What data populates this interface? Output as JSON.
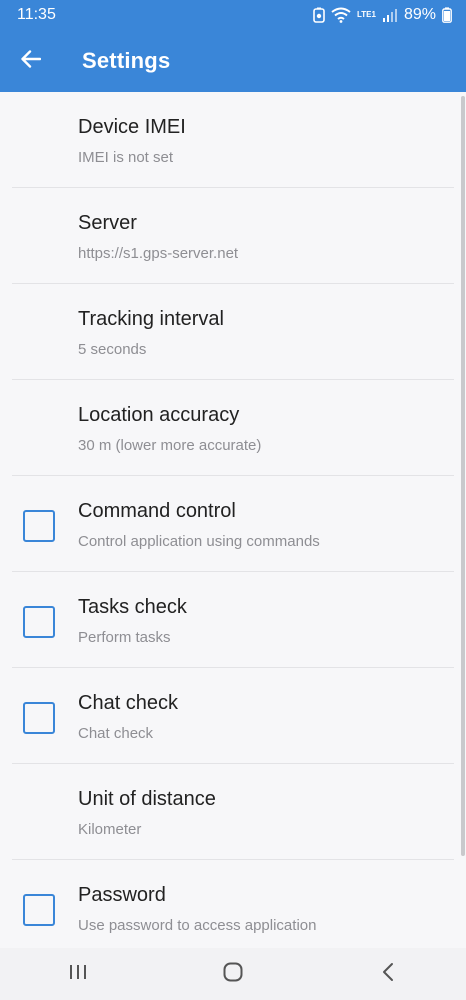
{
  "status_bar": {
    "time": "11:35",
    "network": "LTE1",
    "battery": "89%"
  },
  "app_bar": {
    "title": "Settings",
    "back_icon": "arrow-left-icon"
  },
  "preferences": [
    {
      "title": "Device IMEI",
      "summary": "IMEI is not set",
      "checkbox": false
    },
    {
      "title": "Server",
      "summary": "https://s1.gps-server.net",
      "checkbox": false
    },
    {
      "title": "Tracking interval",
      "summary": "5 seconds",
      "checkbox": false
    },
    {
      "title": "Location accuracy",
      "summary": "30 m (lower more accurate)",
      "checkbox": false
    },
    {
      "title": "Command control",
      "summary": "Control application using commands",
      "checkbox": true,
      "checked": false
    },
    {
      "title": "Tasks check",
      "summary": "Perform tasks",
      "checkbox": true,
      "checked": false
    },
    {
      "title": "Chat check",
      "summary": "Chat check",
      "checkbox": true,
      "checked": false
    },
    {
      "title": "Unit of distance",
      "summary": "Kilometer",
      "checkbox": false
    },
    {
      "title": "Password",
      "summary": "Use password to access application",
      "checkbox": true,
      "checked": false
    }
  ],
  "colors": {
    "accent": "#3a86d8",
    "background": "#f7f7f9",
    "title_text": "#222222",
    "summary_text": "#8e8e93"
  }
}
